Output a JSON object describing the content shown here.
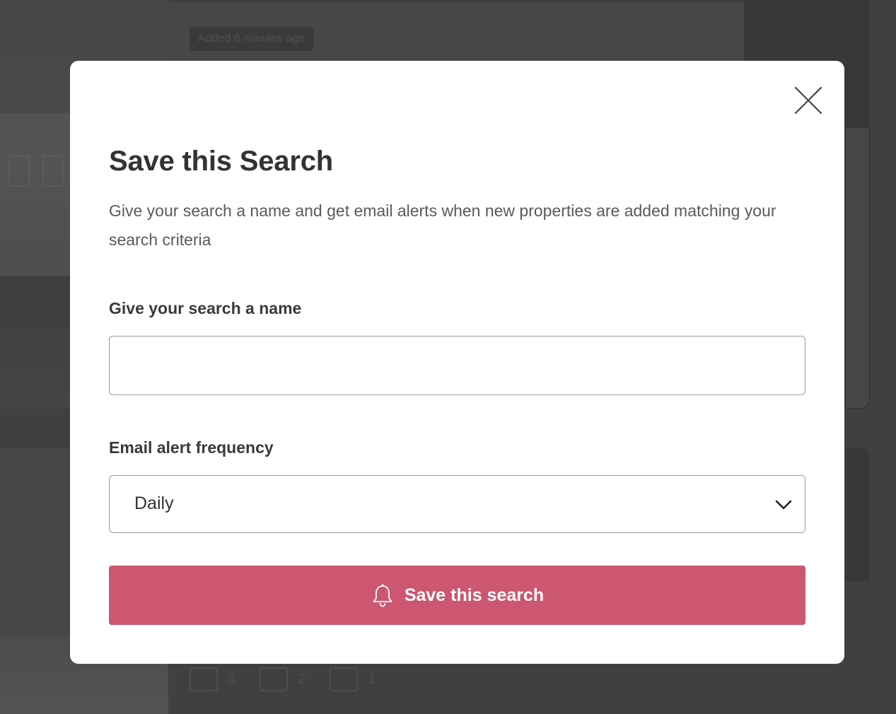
{
  "background": {
    "badge_text": "Added 8 minutes ago",
    "features": [
      {
        "icon": "bed-icon",
        "value": "3"
      },
      {
        "icon": "bath-icon",
        "value": "2"
      },
      {
        "icon": "sofa-icon",
        "value": "1"
      }
    ]
  },
  "modal": {
    "title": "Save this Search",
    "description": "Give your search a name and get email alerts when new properties are added matching your search criteria",
    "name_field": {
      "label": "Give your search a name",
      "value": "",
      "placeholder": ""
    },
    "frequency_field": {
      "label": "Email alert frequency",
      "selected": "Daily"
    },
    "submit_label": "Save this search"
  },
  "colors": {
    "accent": "#cd5670",
    "overlay": "#3f4140",
    "title": "#333333"
  }
}
